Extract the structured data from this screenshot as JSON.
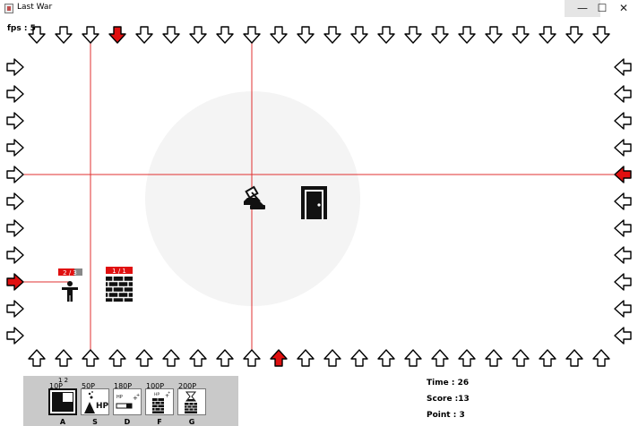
{
  "window": {
    "title": "Last War",
    "minimize_glyph": "—",
    "maximize_glyph": "☐",
    "close_glyph": "✕"
  },
  "hud": {
    "fps_label": "fps : 5",
    "time_label": "Time : 26",
    "score_label": "Score :13",
    "point_label": "Point : 3"
  },
  "units": {
    "player": {
      "hp_label": "2 / 3",
      "hp_fraction": 0.67
    },
    "wall": {
      "hp_label": "1 / 1",
      "hp_fraction": 1.0
    }
  },
  "shop": {
    "selected_count": "1 2",
    "items": [
      {
        "price": "10P",
        "key": "A",
        "icon": "wall-tile-icon"
      },
      {
        "price": "50P",
        "key": "S",
        "icon": "hp-potion-icon",
        "icon_text": "HP"
      },
      {
        "price": "180P",
        "key": "D",
        "icon": "hp-bar-upgrade-icon",
        "icon_text": "HP"
      },
      {
        "price": "100P",
        "key": "F",
        "icon": "wall-hp-upgrade-icon",
        "icon_text": "HP"
      },
      {
        "price": "200P",
        "key": "G",
        "icon": "hourglass-wall-icon"
      }
    ]
  },
  "spawn_arrows": {
    "top_red_index": 3,
    "bottom_red_index": 9,
    "left_red_index": 8,
    "right_red_index": 4
  },
  "colors": {
    "arrow_active": "#e01010",
    "target_line": "#e03030",
    "range_circle": "#f4f4f4",
    "shop_bg": "#c9c9c9",
    "hp_bar": "#e01010"
  }
}
